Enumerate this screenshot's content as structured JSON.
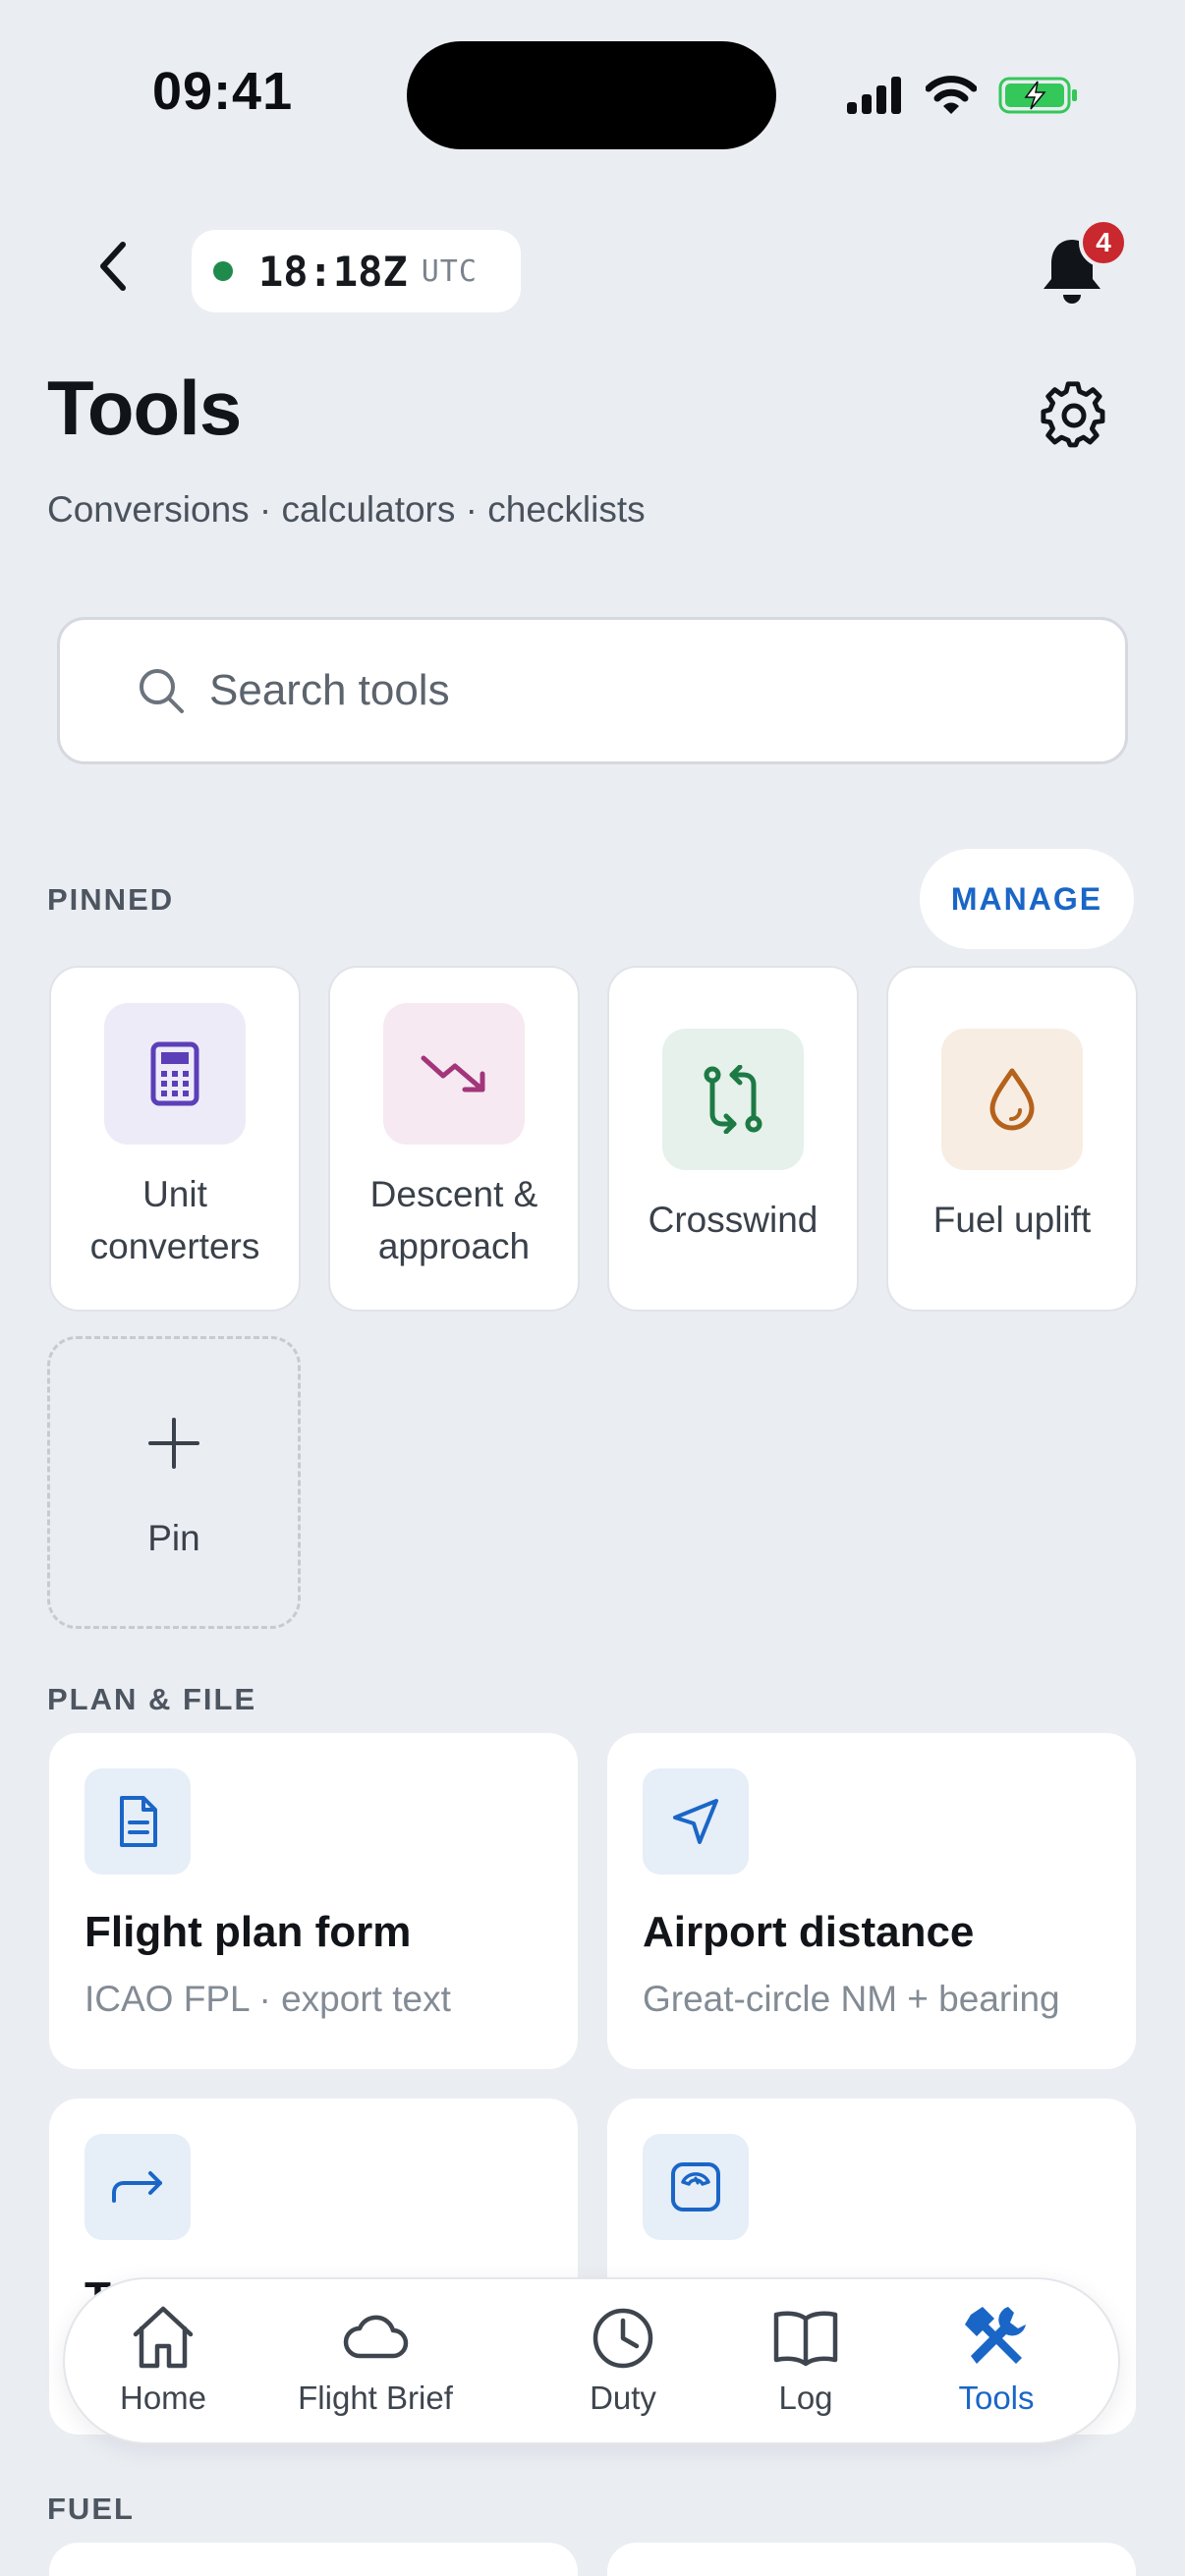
{
  "status_bar": {
    "time": "09:41"
  },
  "header": {
    "utc_time": "18:18Z",
    "utc_label": "UTC",
    "notification_count": "4",
    "title": "Tools",
    "subtitle": "Conversions · calculators · checklists"
  },
  "search": {
    "placeholder": "Search tools"
  },
  "pinned": {
    "label": "PINNED",
    "manage_label": "MANAGE",
    "items": [
      {
        "line1": "Unit",
        "line2": "converters",
        "icon": "calculator-icon",
        "color": "#5B3FB8",
        "bg": "#EEEBF8"
      },
      {
        "line1": "Descent &",
        "line2": "approach",
        "icon": "trending-down-icon",
        "color": "#A3357A",
        "bg": "#F6E9F1"
      },
      {
        "line1": "Crosswind",
        "line2": "",
        "icon": "swap-arrows-icon",
        "color": "#1E7A45",
        "bg": "#E5F1EA"
      },
      {
        "line1": "Fuel uplift",
        "line2": "",
        "icon": "droplet-icon",
        "color": "#B5621B",
        "bg": "#F8EDE3"
      }
    ],
    "add_label": "Pin"
  },
  "plan_file": {
    "label": "PLAN & FILE",
    "cards": [
      {
        "title": "Flight plan form",
        "subtitle": "ICAO FPL · export text",
        "icon": "document-icon"
      },
      {
        "title": "Airport distance",
        "subtitle": "Great-circle NM + bearing",
        "icon": "navigation-arrow-icon"
      },
      {
        "title": "T",
        "subtitle": "",
        "icon": "redirect-arrow-icon"
      },
      {
        "title": "",
        "subtitle": "",
        "icon": "weight-scale-icon"
      }
    ]
  },
  "fuel_section": {
    "label": "FUEL"
  },
  "tabbar": {
    "items": [
      {
        "label": "Home",
        "icon": "home-icon"
      },
      {
        "label": "Flight Brief",
        "icon": "cloud-icon"
      },
      {
        "label": "Duty",
        "icon": "clock-icon"
      },
      {
        "label": "Log",
        "icon": "book-icon"
      },
      {
        "label": "Tools",
        "icon": "tools-icon",
        "active": true
      }
    ]
  },
  "colors": {
    "accent": "#1A66C7",
    "background": "#EAEDF2",
    "badge": "#C8282E",
    "online": "#1E8A4C"
  }
}
